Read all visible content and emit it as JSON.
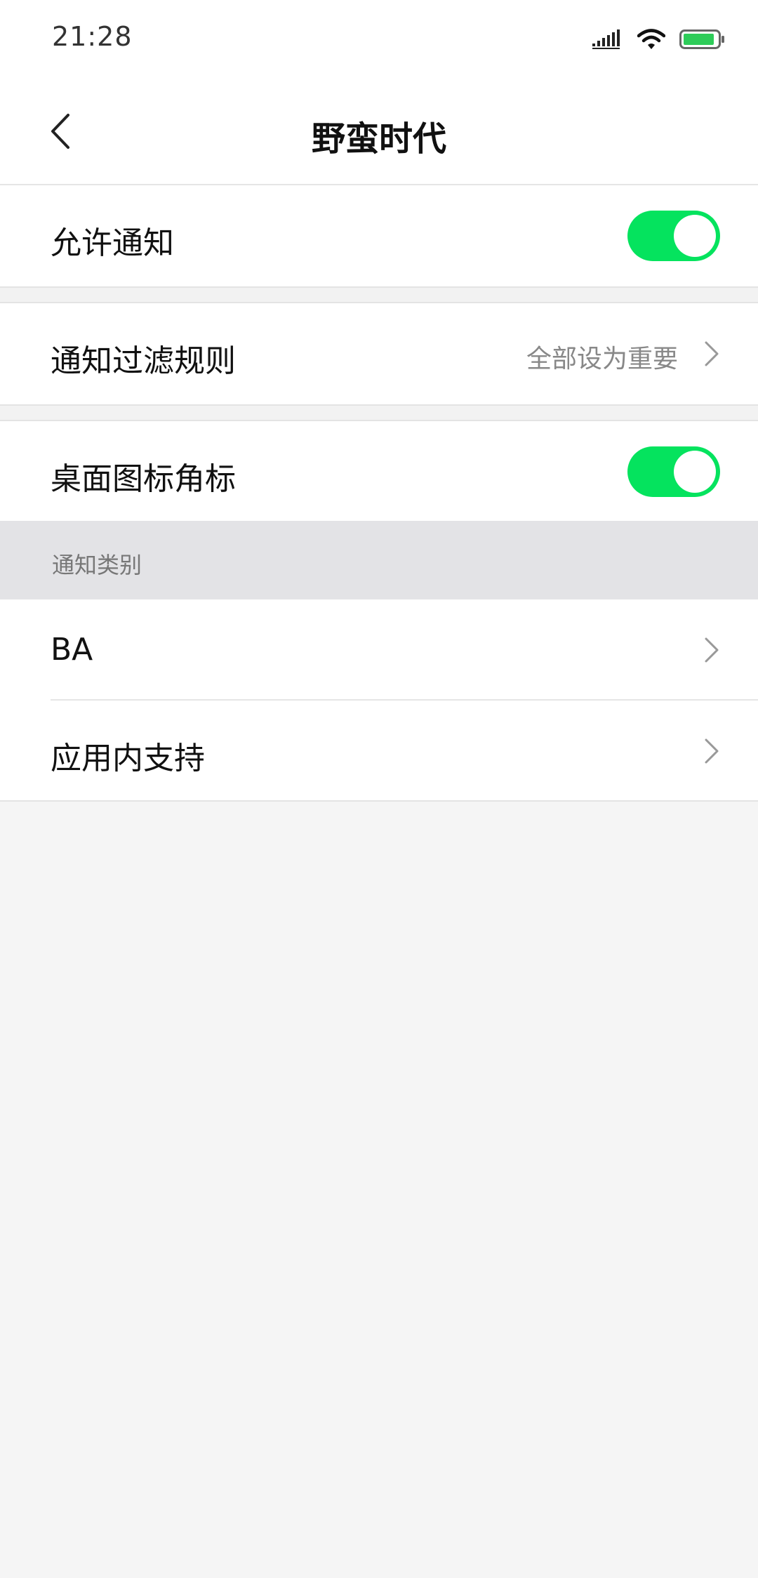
{
  "status_bar": {
    "time": "21:28",
    "icons": [
      "signal-icon",
      "wifi-icon",
      "battery-icon"
    ],
    "battery_color": "#2ecc59"
  },
  "nav": {
    "back_icon": "chevron-left-icon",
    "title": "野蛮时代"
  },
  "settings": {
    "allow_notifications": {
      "label": "允许通知",
      "enabled": true
    },
    "filter_rules": {
      "label": "通知过滤规则",
      "value": "全部设为重要"
    },
    "badge": {
      "label": "桌面图标角标",
      "enabled": true
    }
  },
  "categories": {
    "header": "通知类别",
    "items": [
      {
        "label": "BA"
      },
      {
        "label": "应用内支持"
      }
    ]
  },
  "colors": {
    "toggle_on": "#05e35e",
    "background": "#f5f5f5",
    "section_header_bg": "#e3e3e6"
  }
}
